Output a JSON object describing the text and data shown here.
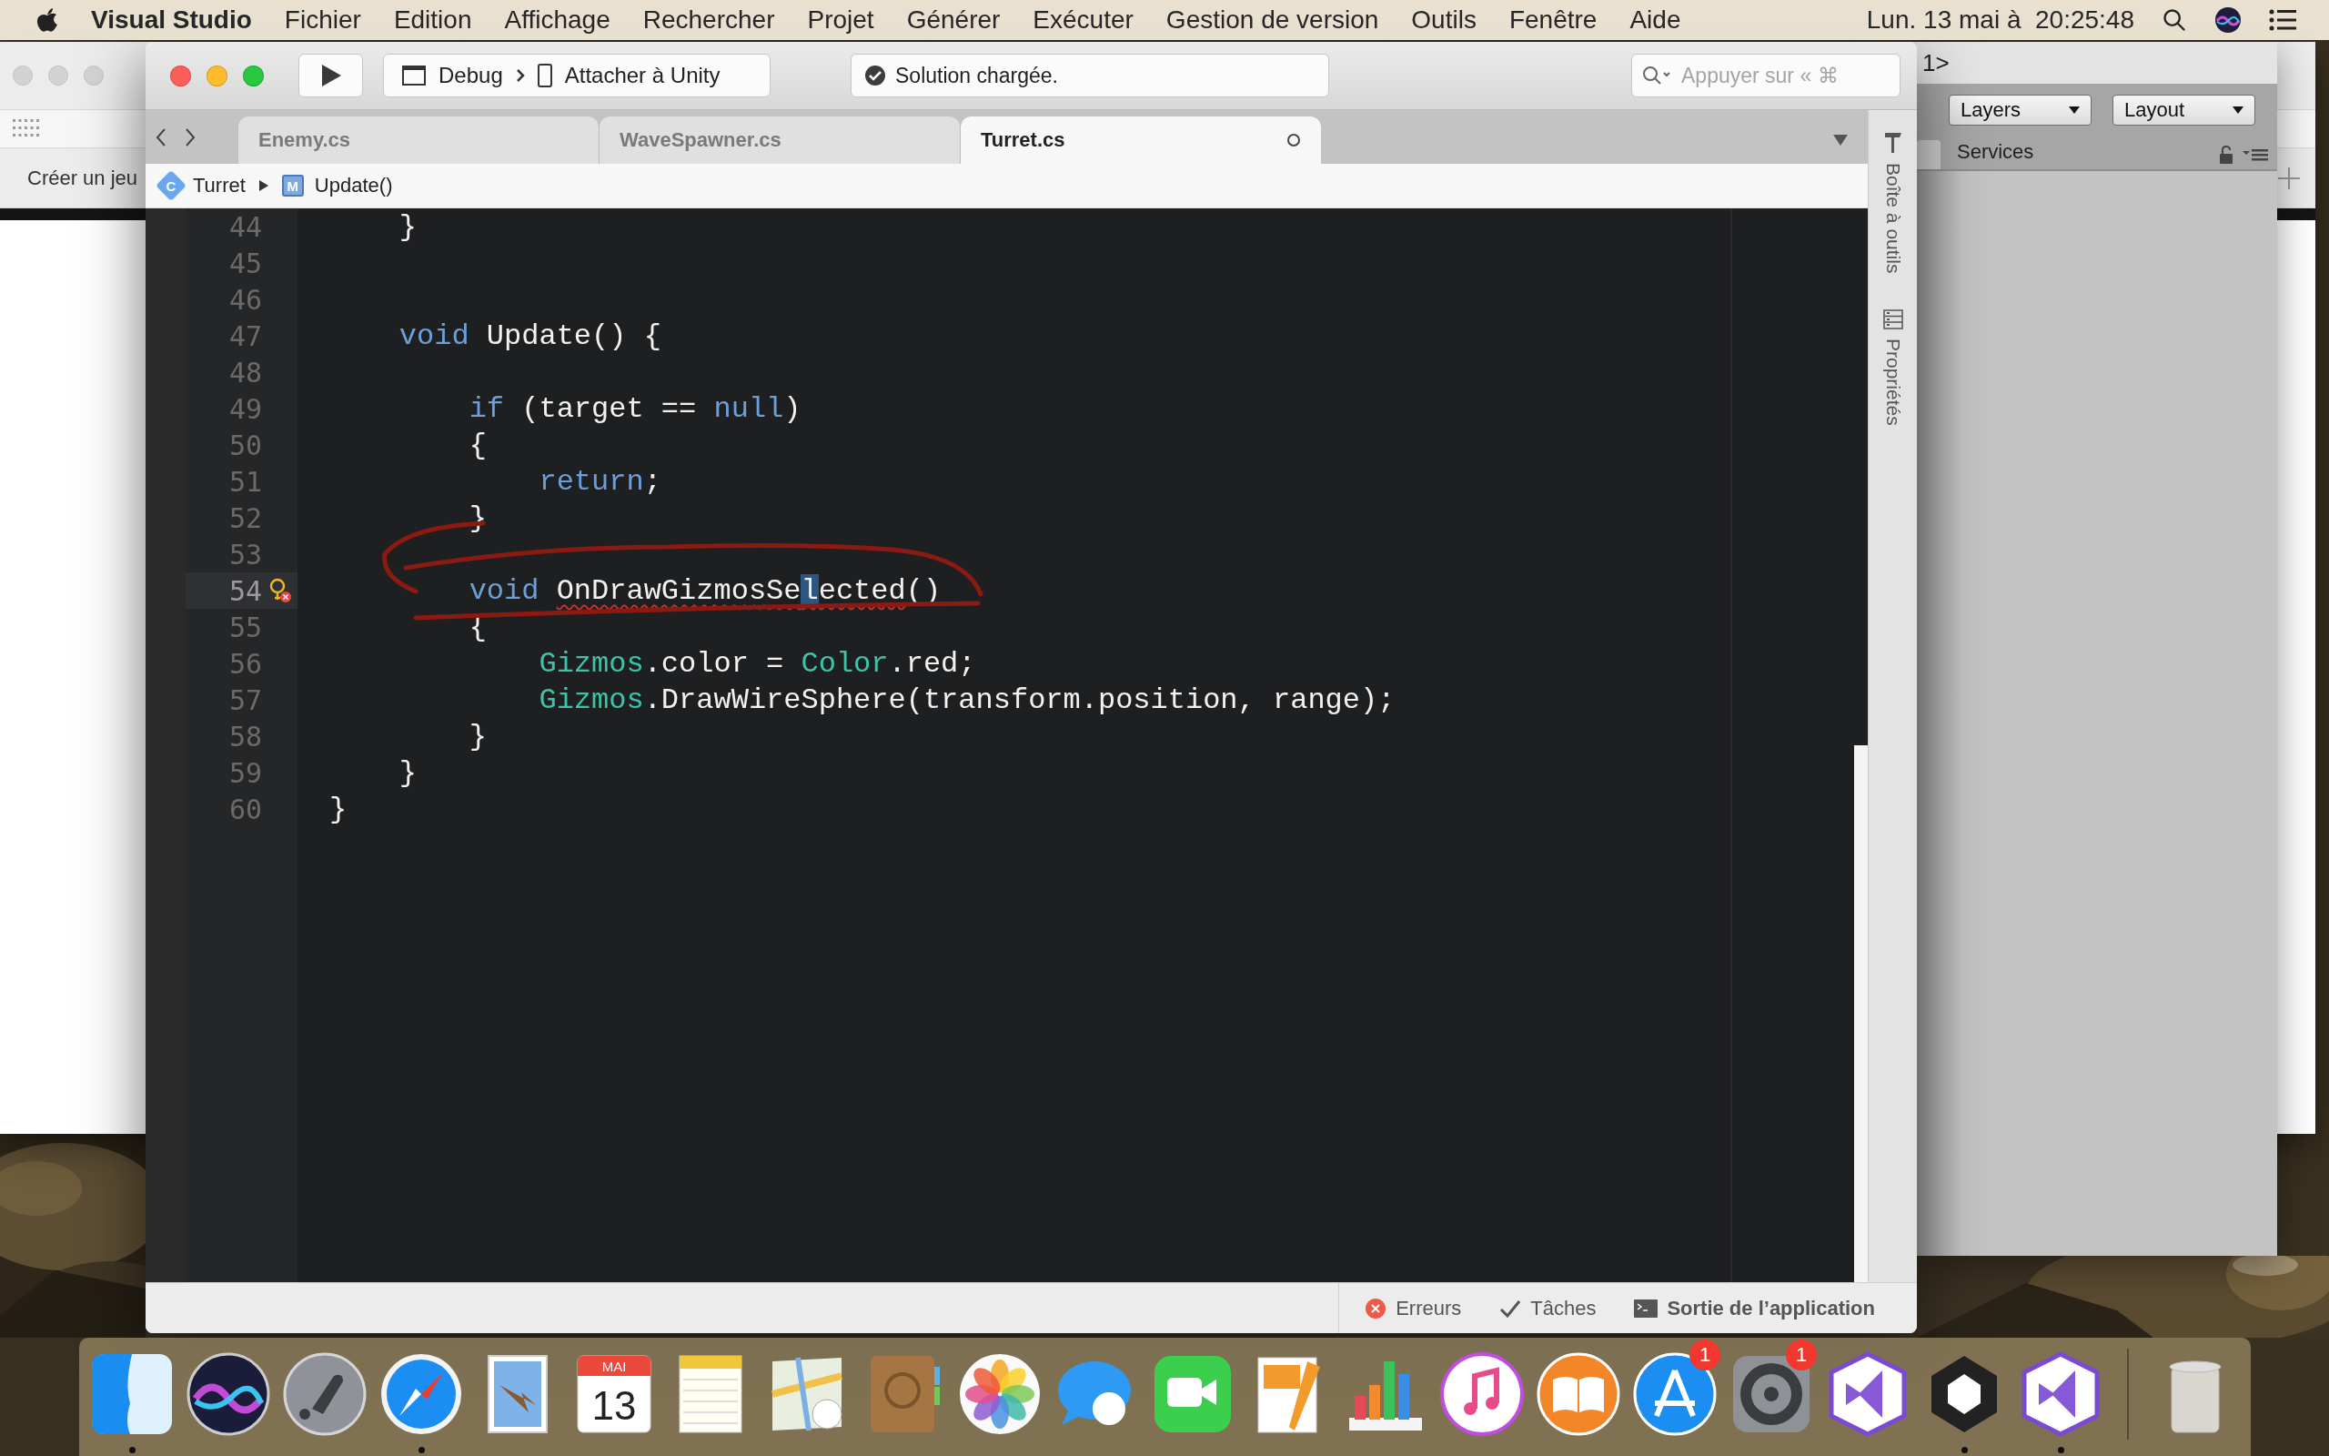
{
  "menu_bar": {
    "app": "Visual Studio",
    "menus": [
      "Fichier",
      "Edition",
      "Affichage",
      "Rechercher",
      "Projet",
      "Générer",
      "Exécuter",
      "Gestion de version",
      "Outils",
      "Fenêtre",
      "Aide"
    ],
    "clock": "Lun. 13 mai à  20:25:48"
  },
  "background_window": {
    "label": "Créer un jeu"
  },
  "unity_panel": {
    "title": "1>",
    "dropdowns": [
      "Layers",
      "Layout"
    ],
    "tab": "Services"
  },
  "editor_window": {
    "toolbar": {
      "configuration": "Debug",
      "target": "Attacher à Unity",
      "status": "Solution chargée.",
      "search": {
        "placeholder": "Appuyer sur « ⌘"
      }
    },
    "tabs": [
      {
        "label": "Enemy.cs",
        "selected": false,
        "modified": false
      },
      {
        "label": "WaveSpawner.cs",
        "selected": false,
        "modified": false
      },
      {
        "label": "Turret.cs",
        "selected": true,
        "modified": true
      }
    ],
    "breadcrumb": [
      {
        "kind": "class",
        "badge": "C",
        "label": "Turret"
      },
      {
        "kind": "method",
        "badge": "M",
        "label": "Update()"
      }
    ],
    "code_lines": [
      {
        "number": "44",
        "current": false,
        "quick_fix": false,
        "tokens": [
          {
            "text": "    }",
            "kind": "plain"
          }
        ]
      },
      {
        "number": "45",
        "current": false,
        "quick_fix": false
      },
      {
        "number": "46",
        "current": false,
        "quick_fix": false
      },
      {
        "number": "47",
        "current": false,
        "quick_fix": false,
        "tokens": [
          {
            "text": "    void",
            "kind": "keyword"
          },
          {
            "text": " Update() {",
            "kind": "plain"
          }
        ]
      },
      {
        "number": "48",
        "current": false,
        "quick_fix": false
      },
      {
        "number": "49",
        "current": false,
        "quick_fix": false,
        "tokens": [
          {
            "text": "        if",
            "kind": "keyword"
          },
          {
            "text": " (target == ",
            "kind": "plain"
          },
          {
            "text": "null",
            "kind": "keyword"
          },
          {
            "text": ")",
            "kind": "plain"
          }
        ]
      },
      {
        "number": "50",
        "current": false,
        "quick_fix": false,
        "tokens": [
          {
            "text": "        {",
            "kind": "plain"
          }
        ]
      },
      {
        "number": "51",
        "current": false,
        "quick_fix": false,
        "tokens": [
          {
            "text": "            return",
            "kind": "keyword"
          },
          {
            "text": ";",
            "kind": "plain"
          }
        ]
      },
      {
        "number": "52",
        "current": false,
        "quick_fix": false,
        "tokens": [
          {
            "text": "        }",
            "kind": "plain"
          }
        ]
      },
      {
        "number": "53",
        "current": false,
        "quick_fix": false
      },
      {
        "number": "54",
        "current": true,
        "quick_fix": true,
        "tokens": [
          {
            "text": "        void ",
            "kind": "keyword"
          },
          {
            "text": "OnDrawGizmosSe",
            "kind": "error"
          },
          {
            "text": "l",
            "kind": "error-caret"
          },
          {
            "text": "ected",
            "kind": "error"
          },
          {
            "text": "()",
            "kind": "plain"
          }
        ]
      },
      {
        "number": "55",
        "current": false,
        "quick_fix": false,
        "tokens": [
          {
            "text": "        {",
            "kind": "plain"
          }
        ]
      },
      {
        "number": "56",
        "current": false,
        "quick_fix": false,
        "tokens": [
          {
            "text": "            Gizmos",
            "kind": "type"
          },
          {
            "text": ".color = ",
            "kind": "plain"
          },
          {
            "text": "Color",
            "kind": "type"
          },
          {
            "text": ".red;",
            "kind": "plain"
          }
        ]
      },
      {
        "number": "57",
        "current": false,
        "quick_fix": false,
        "tokens": [
          {
            "text": "            Gizmos",
            "kind": "type"
          },
          {
            "text": ".DrawWireSphere(transform.position, range);",
            "kind": "plain"
          }
        ]
      },
      {
        "number": "58",
        "current": false,
        "quick_fix": false,
        "tokens": [
          {
            "text": "        }",
            "kind": "plain"
          }
        ]
      },
      {
        "number": "59",
        "current": false,
        "quick_fix": false,
        "tokens": [
          {
            "text": "    }",
            "kind": "plain"
          }
        ]
      },
      {
        "number": "60",
        "current": false,
        "quick_fix": false,
        "tokens": [
          {
            "text": "}",
            "kind": "plain"
          }
        ]
      }
    ],
    "side_pads": [
      {
        "kind": "toolbox",
        "label": "Boîte à outils"
      },
      {
        "kind": "properties",
        "label": "Propriétés"
      }
    ],
    "status_bar": [
      {
        "kind": "errors",
        "label": "Erreurs"
      },
      {
        "kind": "tasks",
        "label": "Tâches"
      },
      {
        "kind": "output",
        "label": "Sortie de l’application"
      }
    ]
  },
  "dock": [
    {
      "kind": "finder",
      "running": true
    },
    {
      "kind": "siri",
      "running": false
    },
    {
      "kind": "launchpad",
      "running": false
    },
    {
      "kind": "safari",
      "running": true
    },
    {
      "kind": "mail",
      "running": false
    },
    {
      "kind": "calendar",
      "running": false,
      "month": "MAI",
      "day": "13"
    },
    {
      "kind": "notes",
      "running": false
    },
    {
      "kind": "maps",
      "running": false
    },
    {
      "kind": "contacts",
      "running": false
    },
    {
      "kind": "photos",
      "running": false
    },
    {
      "kind": "messages",
      "running": false
    },
    {
      "kind": "facetime",
      "running": false
    },
    {
      "kind": "pages",
      "running": false
    },
    {
      "kind": "numbers",
      "running": false
    },
    {
      "kind": "itunes",
      "running": false
    },
    {
      "kind": "ibooks",
      "running": false
    },
    {
      "kind": "appstore",
      "running": false,
      "badge": "1"
    },
    {
      "kind": "settings",
      "running": false,
      "badge": "1"
    },
    {
      "kind": "visualstudio",
      "running": false
    },
    {
      "kind": "unity",
      "running": true
    },
    {
      "kind": "visualstudio",
      "running": true
    },
    {
      "kind": "trash",
      "running": false
    }
  ]
}
